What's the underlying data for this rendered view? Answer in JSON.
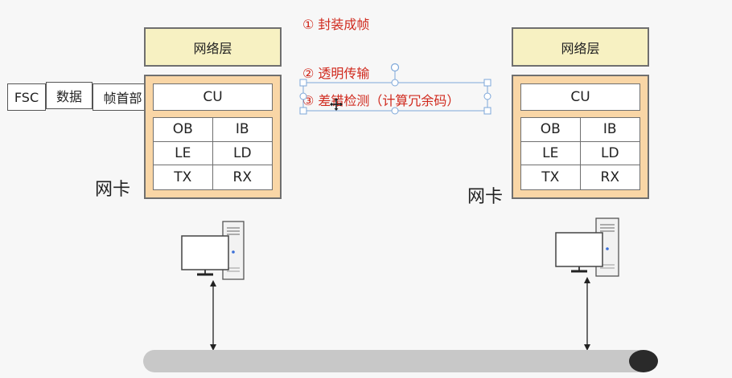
{
  "steps": [
    "① 封装成帧",
    "② 透明传输",
    "③ 差错检测（计算冗余码）"
  ],
  "frame": {
    "fsc": "FSC",
    "data": "数据",
    "header": "帧首部"
  },
  "left_node": {
    "network_layer": "网络层",
    "cu": "CU",
    "cells": [
      "OB",
      "IB",
      "LE",
      "LD",
      "TX",
      "RX"
    ],
    "nic_label": "网卡"
  },
  "right_node": {
    "network_layer": "网络层",
    "cu": "CU",
    "cells": [
      "OB",
      "IB",
      "LE",
      "LD",
      "TX",
      "RX"
    ],
    "nic_label": "网卡"
  },
  "colors": {
    "network_layer_fill": "#f7f1c2",
    "nic_fill": "#f9d6a6",
    "step_text": "#d0291d",
    "cable": "#c8c8c8"
  }
}
